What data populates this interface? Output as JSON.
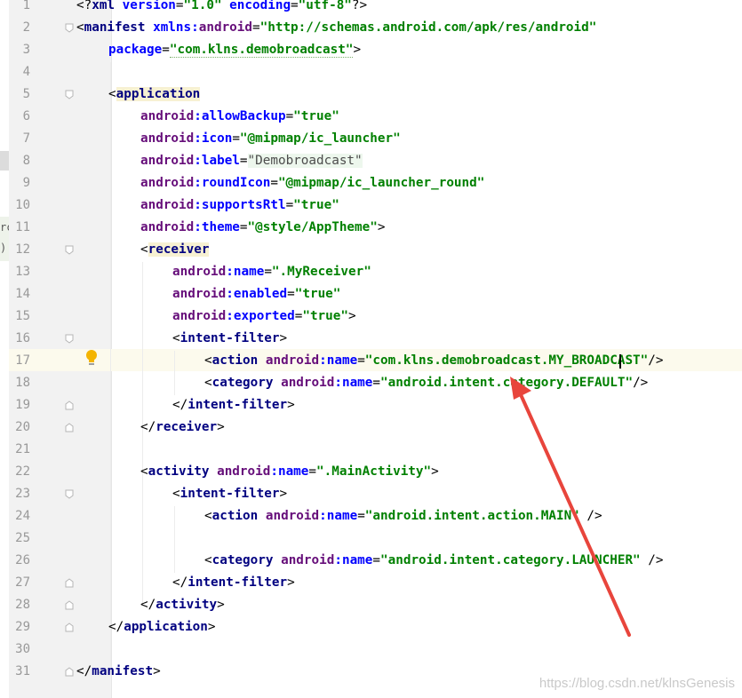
{
  "editor": {
    "line_numbers": [
      "1",
      "2",
      "3",
      "4",
      "5",
      "6",
      "7",
      "8",
      "9",
      "10",
      "11",
      "12",
      "13",
      "14",
      "15",
      "16",
      "17",
      "18",
      "19",
      "20",
      "21",
      "22",
      "23",
      "24",
      "25",
      "26",
      "27",
      "28",
      "29",
      "30",
      "31"
    ],
    "highlighted_line": "17",
    "lines": {
      "l1": {
        "a": "<?",
        "b": "xml",
        "c": " version",
        "d": "=",
        "e": "\"1.0\"",
        "f": " encoding",
        "g": "=",
        "h": "\"utf-8\"",
        "i": "?>"
      },
      "l2": {
        "a": "<",
        "b": "manifest",
        "c": " xmlns:",
        "d": "android",
        "e": "=",
        "f": "\"http://schemas.android.com/apk/res/android\""
      },
      "l3": {
        "a": "package",
        "b": "=",
        "c": "\"com.klns.demobroadcast\"",
        "d": ">"
      },
      "l5": {
        "a": "<",
        "b": "application"
      },
      "l6": {
        "ns": "android",
        "attr": ":allowBackup",
        "eq": "=",
        "val": "\"true\""
      },
      "l7": {
        "ns": "android",
        "attr": ":icon",
        "eq": "=",
        "val": "\"@mipmap/ic_launcher\""
      },
      "l8": {
        "ns": "android",
        "attr": ":label",
        "eq": "=",
        "val": "\"Demobroadcast\""
      },
      "l9": {
        "ns": "android",
        "attr": ":roundIcon",
        "eq": "=",
        "val": "\"@mipmap/ic_launcher_round\""
      },
      "l10": {
        "ns": "android",
        "attr": ":supportsRtl",
        "eq": "=",
        "val": "\"true\""
      },
      "l11": {
        "ns": "android",
        "attr": ":theme",
        "eq": "=",
        "val": "\"@style/AppTheme\"",
        "end": ">"
      },
      "l12": {
        "a": "<",
        "b": "receiver"
      },
      "l13": {
        "ns": "android",
        "attr": ":name",
        "eq": "=",
        "val": "\".MyReceiver\""
      },
      "l14": {
        "ns": "android",
        "attr": ":enabled",
        "eq": "=",
        "val": "\"true\""
      },
      "l15": {
        "ns": "android",
        "attr": ":exported",
        "eq": "=",
        "val": "\"true\"",
        "end": ">"
      },
      "l16": {
        "a": "<",
        "b": "intent-filter",
        "c": ">"
      },
      "l17": {
        "a": "<",
        "b": "action",
        "ns": " android",
        "attr": ":name",
        "eq": "=",
        "val": "\"com.klns.demobroadcast.MY_BROADCAST\"",
        "end": "/>"
      },
      "l18": {
        "a": "<",
        "b": "category",
        "ns": " android",
        "attr": ":name",
        "eq": "=",
        "val": "\"android.intent.category.DEFAULT\"",
        "end": "/>"
      },
      "l19": {
        "a": "</",
        "b": "intent-filter",
        "c": ">"
      },
      "l20": {
        "a": "</",
        "b": "receiver",
        "c": ">"
      },
      "l22": {
        "a": "<",
        "b": "activity",
        "ns": " android",
        "attr": ":name",
        "eq": "=",
        "val": "\".MainActivity\"",
        "end": ">"
      },
      "l23": {
        "a": "<",
        "b": "intent-filter",
        "c": ">"
      },
      "l24": {
        "a": "<",
        "b": "action",
        "ns": " android",
        "attr": ":name",
        "eq": "=",
        "val": "\"android.intent.action.MAIN\"",
        "end": " />"
      },
      "l26": {
        "a": "<",
        "b": "category",
        "ns": " android",
        "attr": ":name",
        "eq": "=",
        "val": "\"android.intent.category.LAUNCHER\"",
        "end": " />"
      },
      "l27": {
        "a": "</",
        "b": "intent-filter",
        "c": ">"
      },
      "l28": {
        "a": "</",
        "b": "activity",
        "c": ">"
      },
      "l29": {
        "a": "</",
        "b": "application",
        "c": ">"
      },
      "l31": {
        "a": "</",
        "b": "manifest",
        "c": ">"
      }
    }
  },
  "side_fragments": {
    "frag1": "rc",
    "frag2": ")"
  },
  "annotation": {
    "arrow_color": "#e8453c"
  },
  "watermark": "https://blog.csdn.net/klnsGenesis",
  "colors": {
    "tag": "#000080",
    "attr": "#660e7a",
    "namespace": "#0000ff",
    "string": "#008000",
    "highlight_line": "#fcfaed",
    "gutter": "#f2f2f2"
  },
  "icons": [
    "intention-bulb-icon",
    "fold-marker-icon"
  ]
}
